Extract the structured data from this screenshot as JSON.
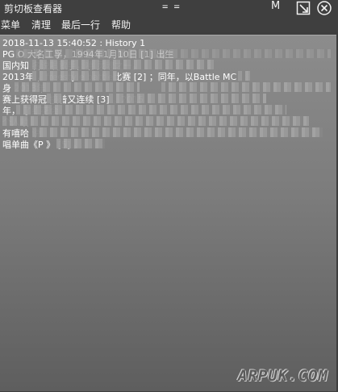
{
  "window": {
    "title": "剪切板查看器",
    "center_mark": "= =",
    "mode_letter": "M",
    "pin_icon": "pin-corner-icon",
    "close_icon": "close-circle-icon"
  },
  "menu": [
    {
      "label": "菜单"
    },
    {
      "label": "清理"
    },
    {
      "label": "最后一行"
    },
    {
      "label": "帮助"
    }
  ],
  "entry": {
    "lines": [
      "2018-11-13 15:40:52 : History 1",
      "PG O         大名工孚，1994年1月10日 [1] 出生",
      "国内知       名说唱歌手，嘻           灵魂之一。",
      "2013年                   ，freestyle battle比赛 [2] ；同年，以Battle MC",
      "身                              2013年",
      "赛上获得冠         接着又连续                                      [3] 。2015",
      "年，                                                                         了红花会",
      "                                                                                  个人嘻",
      "有嘻哈                                                                           说",
      "唱单曲《P            》 [5] 。"
    ]
  },
  "watermark": "ARPUK.COM",
  "colors": {
    "titlebar": "#3f3f3f",
    "content_top": "#8c8c8c",
    "content_bottom": "#5e5e5e",
    "text": "#ffffff"
  }
}
